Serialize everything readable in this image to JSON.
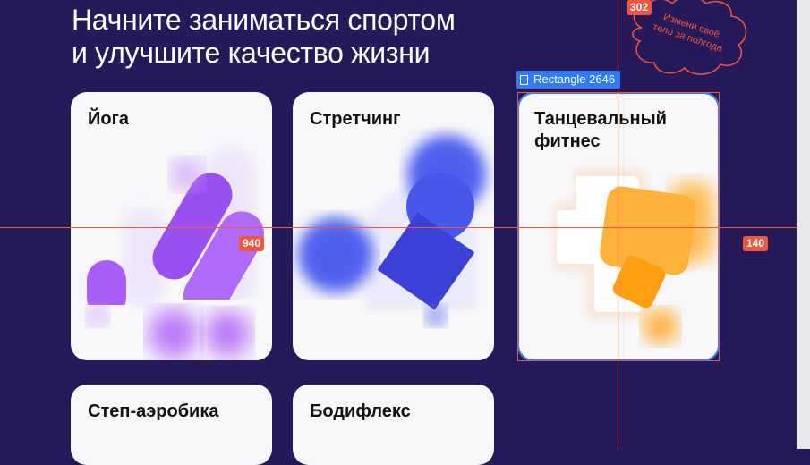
{
  "headline": {
    "line1": "Начните заниматься спортом",
    "line2": "и улучшите качество жизни"
  },
  "badge": {
    "line1": "Измени своё",
    "line2": "тело за полгода"
  },
  "cards": [
    {
      "title": "Йога"
    },
    {
      "title": "Стретчинг"
    },
    {
      "title_line1": "Танцевальный",
      "title_line2": "фитнес"
    },
    {
      "title": "Степ-аэробика"
    },
    {
      "title": "Бодифлекс"
    }
  ],
  "editor": {
    "selected_layer": "Rectangle 2646",
    "measure_top": "302",
    "measure_left": "940",
    "measure_right": "140"
  },
  "colors": {
    "background": "#261a5a",
    "card": "#f7f7fa",
    "selection": "#2e7cf6",
    "guide": "#f0553e",
    "purple": "#a45cf5",
    "blue": "#3a45d8",
    "orange": "#ffaa2e"
  }
}
